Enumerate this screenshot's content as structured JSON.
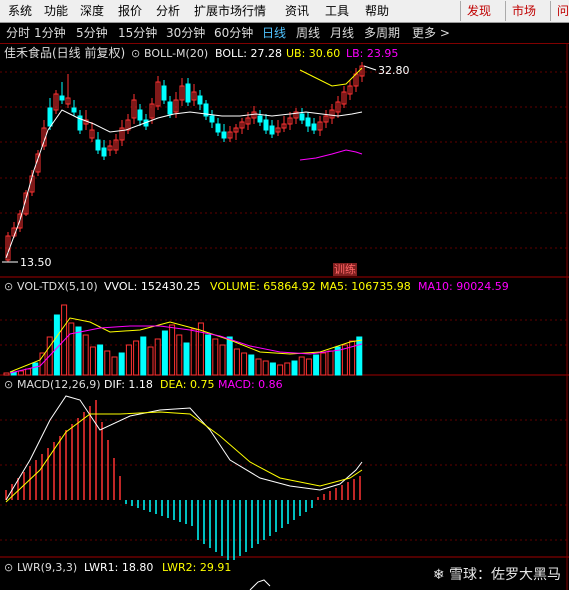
{
  "menu": {
    "items": [
      "系统",
      "功能",
      "深度",
      "报价",
      "分析",
      "扩展市场行情",
      "资讯",
      "工具",
      "帮助"
    ],
    "right_buttons": [
      "发现",
      "市场",
      "问"
    ]
  },
  "timeframes": {
    "items": [
      "分时",
      "1分钟",
      "5分钟",
      "15分钟",
      "30分钟",
      "60分钟",
      "日线",
      "周线",
      "月线",
      "多周期",
      "更多 >"
    ],
    "active": "日线"
  },
  "main": {
    "stock_title": "佳禾食品(日线 前复权)",
    "boll_label": "BOLL-M(20)",
    "boll_value": "BOLL: 27.28",
    "ub": "UB: 30.60",
    "lb": "LB: 23.95",
    "high_mark": "32.80",
    "low_mark": "13.50",
    "badge": "训练"
  },
  "vol": {
    "label": "VOL-TDX(5,10)",
    "vvol": "VVOL: 152430.25",
    "volume": "VOLUME: 65864.92",
    "ma5": "MA5: 106735.98",
    "ma10": "MA10: 90024.59"
  },
  "macd": {
    "label": "MACD(12,26,9)",
    "dif": "DIF: 1.18",
    "dea": "DEA: 0.75",
    "macd": "MACD: 0.86"
  },
  "lwr": {
    "label": "LWR(9,3,3)",
    "lwr1": "LWR1: 18.80",
    "lwr2": "LWR2: 29.91"
  },
  "watermark": "雪球：佐罗大黑马",
  "colors": {
    "up": "#ff3232",
    "down": "#00ffff",
    "white": "#ffffff",
    "yellow": "#ffff00",
    "magenta": "#ff00ff",
    "blue_active": "#4fc3ff",
    "grid": "#800000"
  },
  "icons": {
    "indicator_toggle": "circle-chevron-icon",
    "watermark_logo": "snowball-logo-icon"
  }
}
